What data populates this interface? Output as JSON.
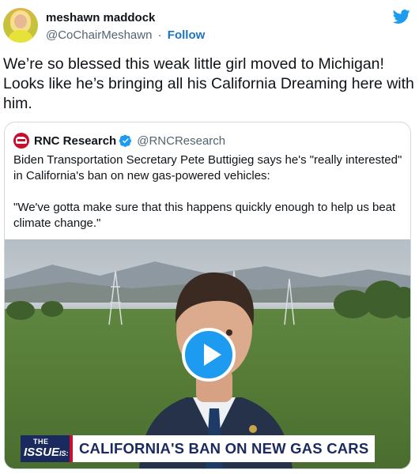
{
  "author": {
    "name": "meshawn maddock",
    "handle": "@CoChairMeshawn",
    "separator": "·",
    "follow_label": "Follow"
  },
  "tweet_text": "We’re so blessed this weak little girl moved to Michigan! Looks like he’s bringing all his California Dreaming here with him.",
  "quoted": {
    "name": "RNC Research",
    "handle": "@RNCResearch",
    "paragraphs": [
      "Biden Transportation Secretary Pete Buttigieg says he's \"really interested\" in California's ban on new gas-powered vehicles:",
      "\"We've gotta make sure that this happens quickly enough to help us beat climate change.\""
    ],
    "video": {
      "chyron_the": "THE",
      "chyron_issue": "ISSUE",
      "chyron_is": "IS:",
      "headline": "CALIFORNIA'S BAN ON NEW GAS CARS"
    }
  },
  "icons": {
    "platform": "twitter-bird-icon",
    "verified": "verified-badge-icon",
    "play": "play-icon"
  },
  "colors": {
    "accent": "#1d9bf0",
    "follow": "#1b74c4",
    "rnc_red": "#c8102e",
    "chyron_navy": "#1a2a5e"
  }
}
